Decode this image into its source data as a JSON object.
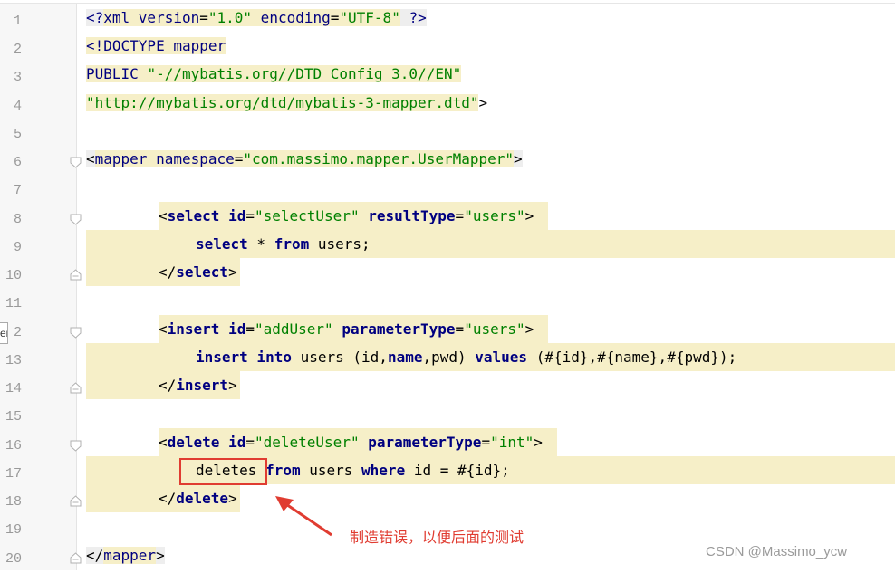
{
  "editor": {
    "line_numbers": [
      "1",
      "2",
      "3",
      "4",
      "5",
      "6",
      "7",
      "8",
      "9",
      "10",
      "11",
      "2",
      "13",
      "14",
      "15",
      "16",
      "17",
      "18",
      "19",
      "20"
    ],
    "tab_marker": "er",
    "lines": {
      "l1_a": "<?",
      "l1_b": "xml version",
      "l1_c": "=",
      "l1_d": "\"1.0\"",
      "l1_e": " encoding",
      "l1_f": "=",
      "l1_g": "\"UTF-8\"",
      "l1_h": " ?>",
      "l2": "<!DOCTYPE mapper",
      "l3_a": "PUBLIC ",
      "l3_b": "\"-//mybatis.org//DTD Config 3.0//EN\"",
      "l4_a": "\"http://mybatis.org/dtd/mybatis-3-mapper.dtd\"",
      "l4_b": ">",
      "l6_a": "<",
      "l6_b": "mapper",
      "l6_c": " namespace",
      "l6_d": "=",
      "l6_e": "\"com.massimo.mapper.UserMapper\"",
      "l6_f": ">",
      "l8_a": "<",
      "l8_b": "select",
      "l8_c": " id",
      "l8_d": "=",
      "l8_e": "\"selectUser\"",
      "l8_f": " resultType",
      "l8_g": "=",
      "l8_h": "\"users\"",
      "l8_i": ">",
      "l9_a": "select",
      "l9_b": " * ",
      "l9_c": "from",
      "l9_d": " users;",
      "l10_a": "</",
      "l10_b": "select",
      "l10_c": ">",
      "l12_a": "<",
      "l12_b": "insert",
      "l12_c": " id",
      "l12_d": "=",
      "l12_e": "\"addUser\"",
      "l12_f": " parameterType",
      "l12_g": "=",
      "l12_h": "\"users\"",
      "l12_i": ">",
      "l13_a": "insert",
      "l13_b": " ",
      "l13_c": "into",
      "l13_d": " users (id,",
      "l13_e": "name",
      "l13_f": ",pwd) ",
      "l13_g": "values",
      "l13_h": " (#{id},#{name},#{pwd});",
      "l14_a": "</",
      "l14_b": "insert",
      "l14_c": ">",
      "l16_a": "<",
      "l16_b": "delete",
      "l16_c": " id",
      "l16_d": "=",
      "l16_e": "\"deleteUser\"",
      "l16_f": " parameterType",
      "l16_g": "=",
      "l16_h": "\"int\"",
      "l16_i": ">",
      "l17_a": "deletes ",
      "l17_b": "from",
      "l17_c": " users ",
      "l17_d": "where",
      "l17_e": " id = #{id};",
      "l18_a": "</",
      "l18_b": "delete",
      "l18_c": ">",
      "l20_a": "</",
      "l20_b": "mapper",
      "l20_c": ">"
    }
  },
  "annotation": "制造错误，以便后面的测试",
  "watermark": "CSDN @Massimo_ycw",
  "colors": {
    "accent": "#e03c31",
    "highlight": "#f6efc8",
    "string": "#008000",
    "tag": "#000080"
  }
}
